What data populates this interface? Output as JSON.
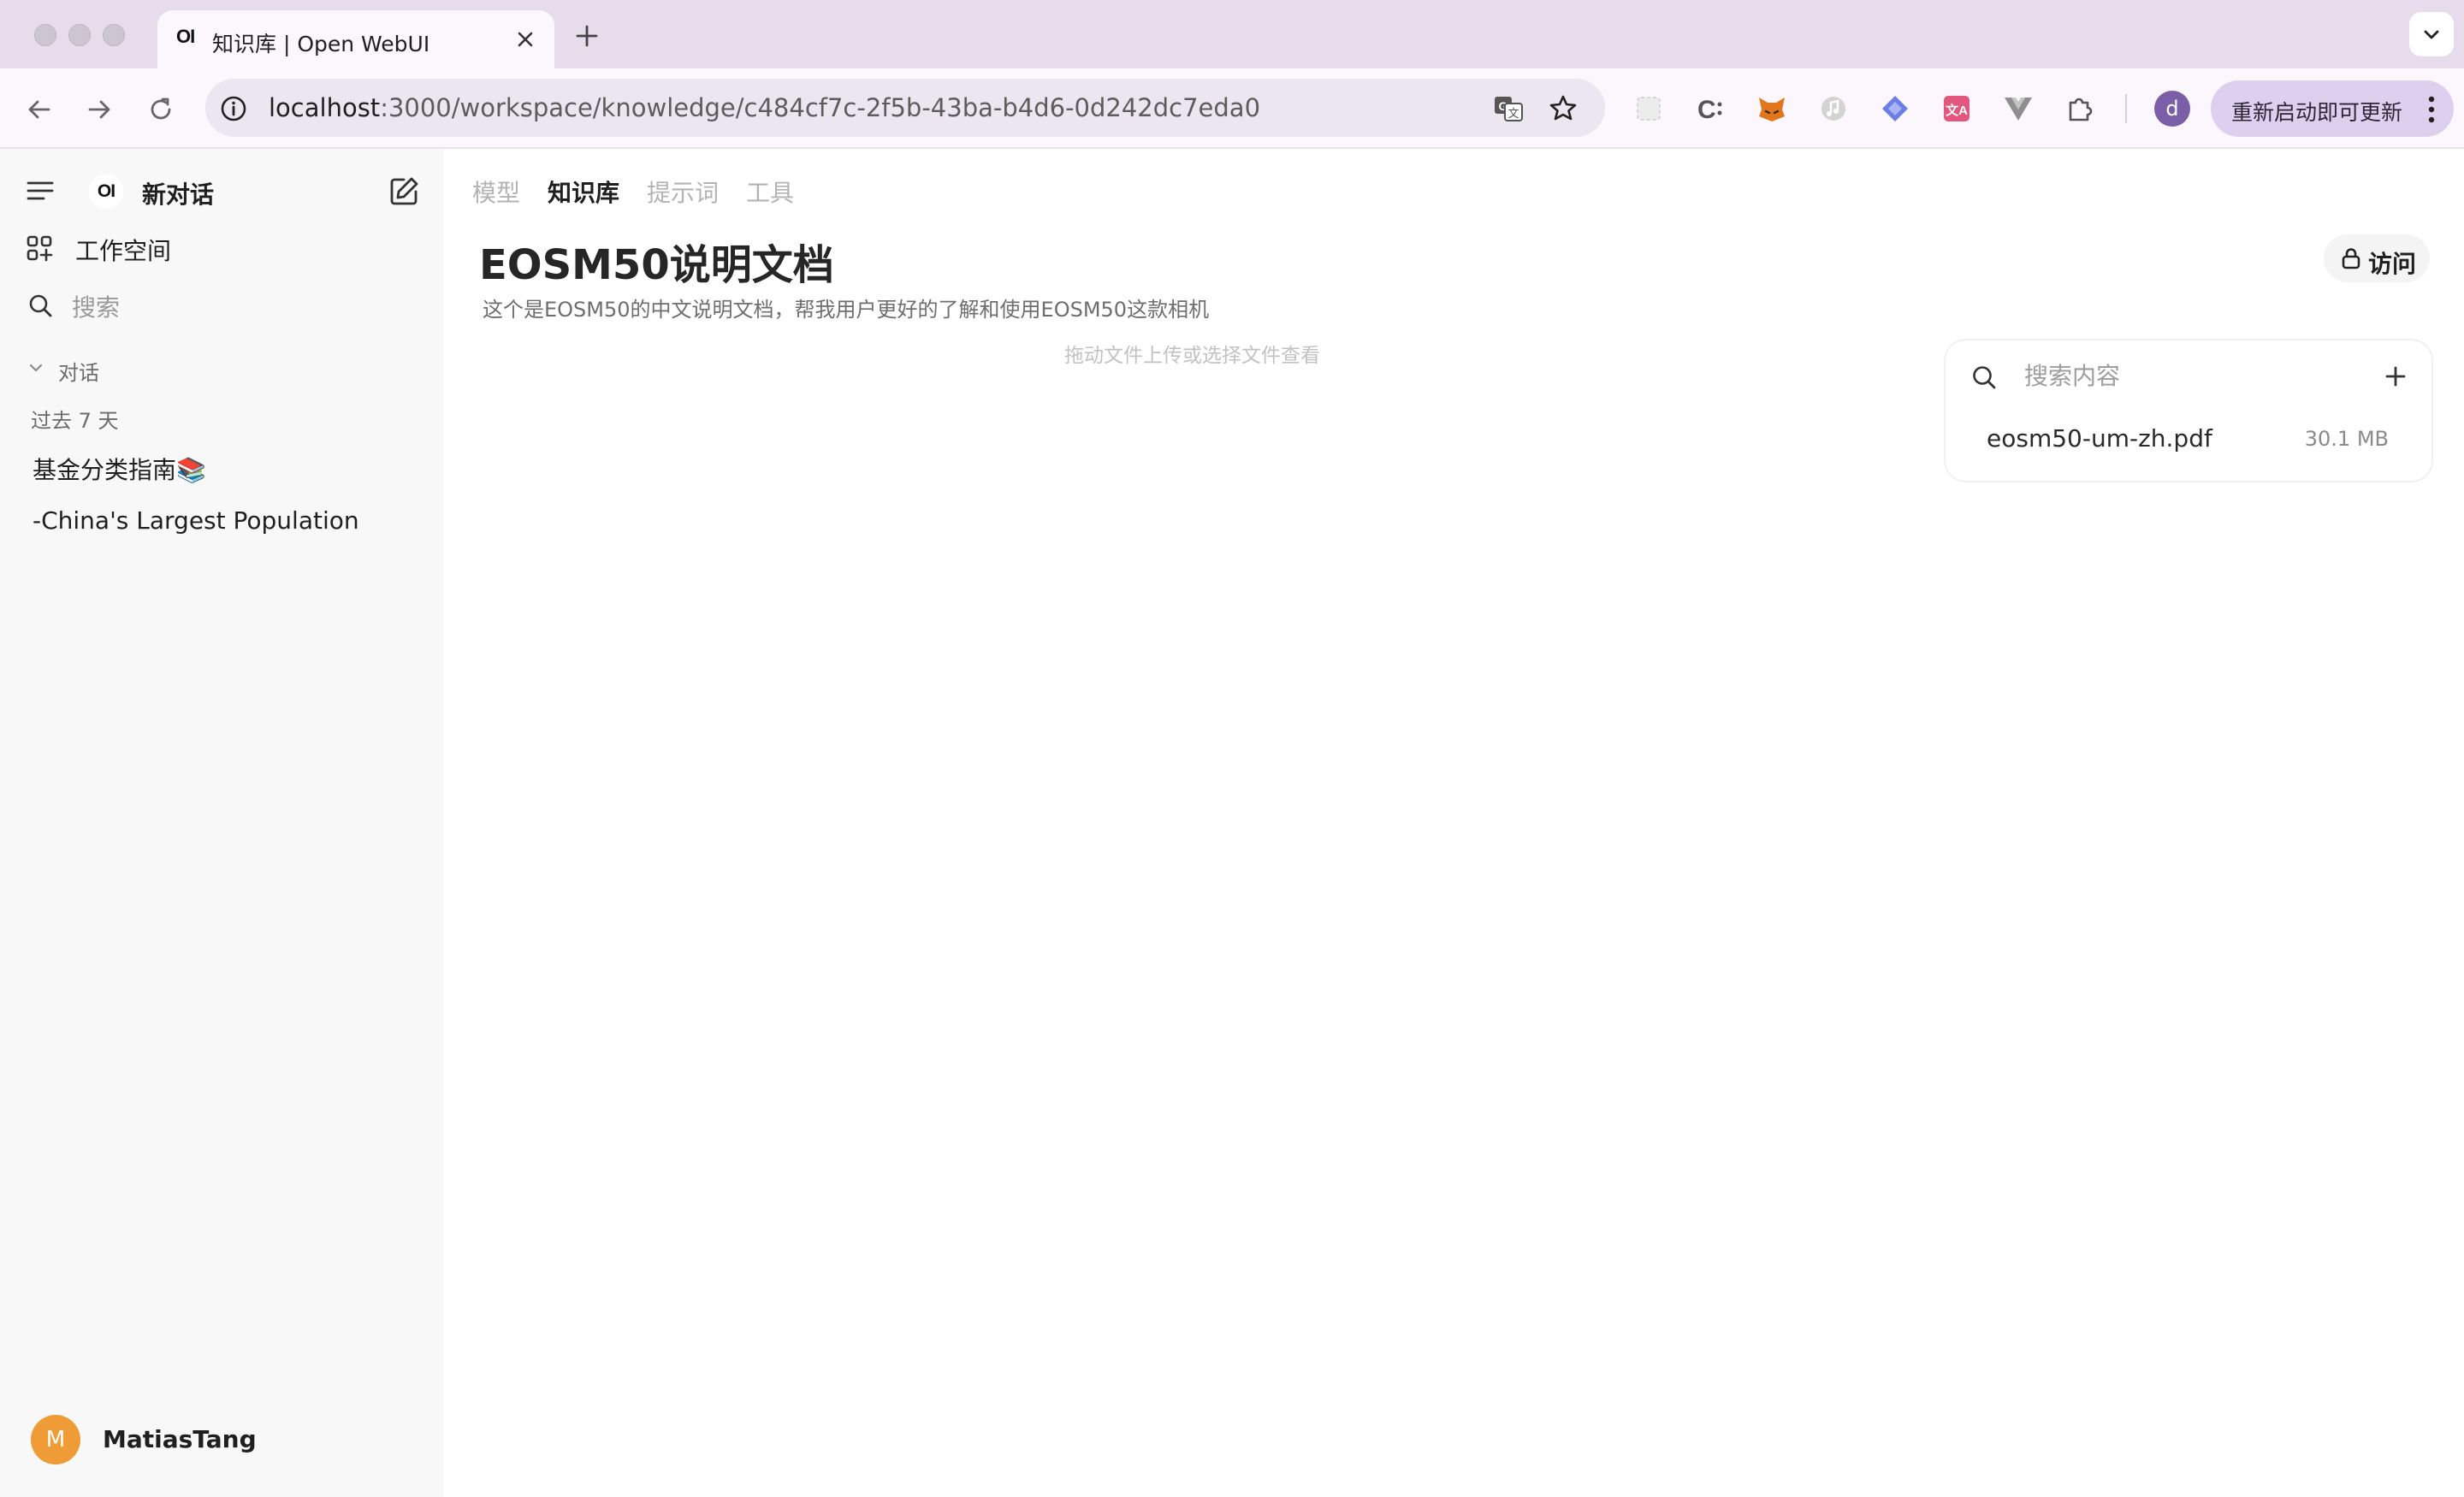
{
  "browser": {
    "tab_logo": "OI",
    "tab_title": "知识库 | Open WebUI",
    "url_host": "localhost",
    "url_rest": ":3000/workspace/knowledge/c484cf7c-2f5b-43ba-b4d6-0d242dc7eda0",
    "profile_initial": "d",
    "update_label": "重新启动即可更新",
    "extensions": [
      "screenshot-icon",
      "c-icon",
      "fox-icon",
      "music-icon",
      "diamond-icon",
      "translate-icon",
      "vue-icon",
      "puzzle-icon"
    ]
  },
  "sidebar": {
    "logo": "OI",
    "new_chat": "新对话",
    "workspace": "工作空间",
    "search_placeholder": "搜索",
    "section": "对话",
    "group": "过去 7 天",
    "chats": [
      "基金分类指南📚",
      "-China's Largest Population"
    ],
    "user": {
      "initial": "M",
      "name": "MatiasTang"
    }
  },
  "main": {
    "nav": [
      "模型",
      "知识库",
      "提示词",
      "工具"
    ],
    "active_nav": "知识库",
    "title": "EOSM50说明文档",
    "description": "这个是EOSM50的中文说明文档，帮我用户更好的了解和使用EOSM50这款相机",
    "drop_hint": "拖动文件上传或选择文件查看",
    "access_label": "访问",
    "file_panel": {
      "search_placeholder": "搜索内容",
      "files": [
        {
          "name": "eosm50-um-zh.pdf",
          "size": "30.1 MB"
        }
      ]
    }
  },
  "colors": {
    "titlebar": "#e6dcec",
    "toolbar": "#fbf7fd",
    "update_button": "#ddd0ef",
    "avatar": "#ef9c37",
    "profile": "#7a5ea8"
  }
}
